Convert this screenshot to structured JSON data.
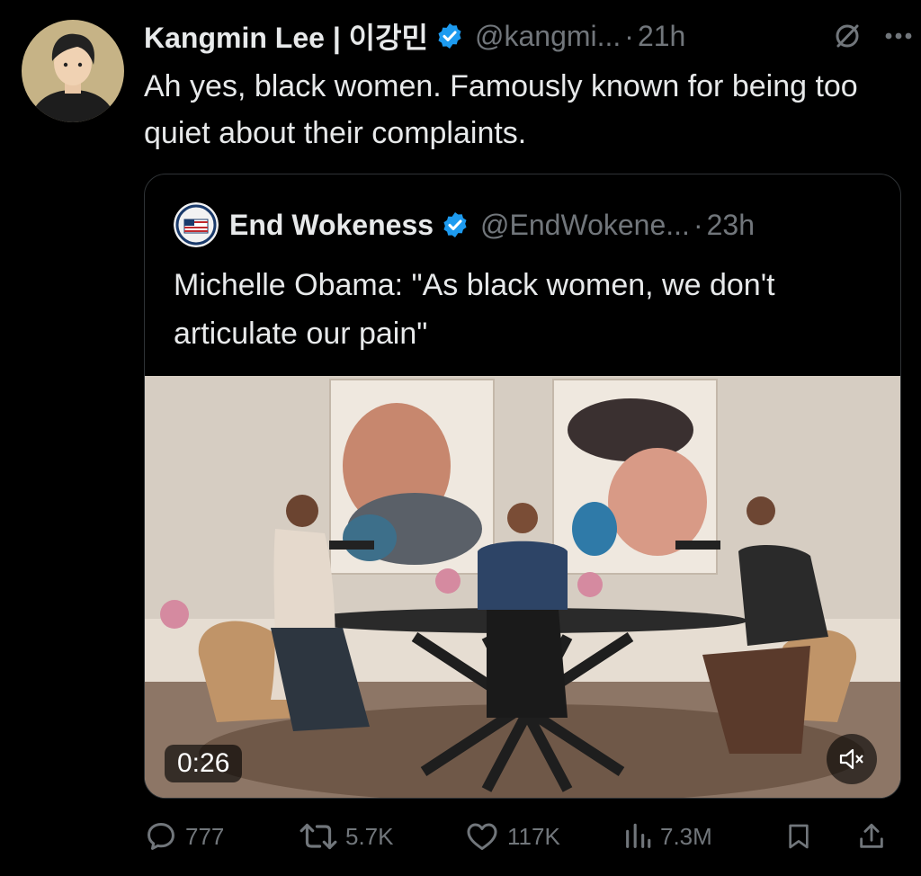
{
  "tweet": {
    "author_name": "Kangmin Lee | 이강민",
    "handle": "@kangmi...",
    "dot": "·",
    "time": "21h",
    "text": "Ah yes, black women. Famously known for being too quiet about their complaints.",
    "icons": {
      "avatar": "avatar",
      "verified": "verified-badge-icon",
      "grok": "grok-icon",
      "more": "more-icon"
    }
  },
  "quote": {
    "author_name": "End Wokeness",
    "handle": "@EndWokene...",
    "dot": "·",
    "time": "23h",
    "text": "Michelle Obama: \"As black women, we don't articulate our pain\"",
    "video": {
      "duration": "0:26",
      "mute_icon": "volume-mute-icon"
    }
  },
  "actions": {
    "replies": "777",
    "reposts": "5.7K",
    "likes": "117K",
    "views": "7.3M",
    "icons": [
      "reply-icon",
      "repost-icon",
      "like-icon",
      "views-icon",
      "bookmark-icon",
      "share-icon"
    ]
  },
  "colors": {
    "background": "#000000",
    "text": "#e7e9ea",
    "muted": "#71767b",
    "verified": "#1d9bf0",
    "border": "#2f3336"
  }
}
